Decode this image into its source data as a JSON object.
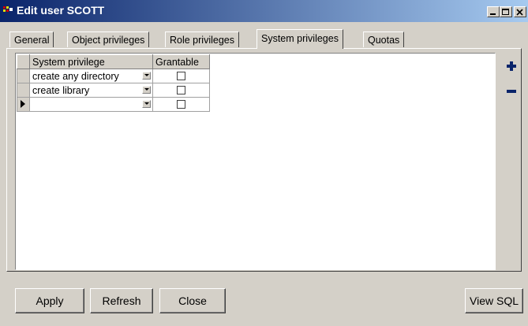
{
  "window": {
    "title": "Edit user SCOTT"
  },
  "tabs": [
    {
      "label": "General"
    },
    {
      "label": "Object privileges"
    },
    {
      "label": "Role privileges"
    },
    {
      "label": "System privileges",
      "active": true
    },
    {
      "label": "Quotas"
    }
  ],
  "grid": {
    "columns": [
      "System privilege",
      "Grantable"
    ],
    "rows": [
      {
        "privilege": "create any directory",
        "grantable": false
      },
      {
        "privilege": "create library",
        "grantable": false
      },
      {
        "privilege": "",
        "grantable": false,
        "current": true
      }
    ]
  },
  "side_buttons": {
    "add": "+",
    "remove": "−"
  },
  "buttons": {
    "apply": "Apply",
    "refresh": "Refresh",
    "close": "Close",
    "view_sql": "View SQL"
  },
  "colors": {
    "title_gradient_start": "#0a246a",
    "title_gradient_end": "#a6caf0",
    "face": "#d4d0c8",
    "add_icon": "#0a246a",
    "remove_icon": "#0a246a"
  }
}
